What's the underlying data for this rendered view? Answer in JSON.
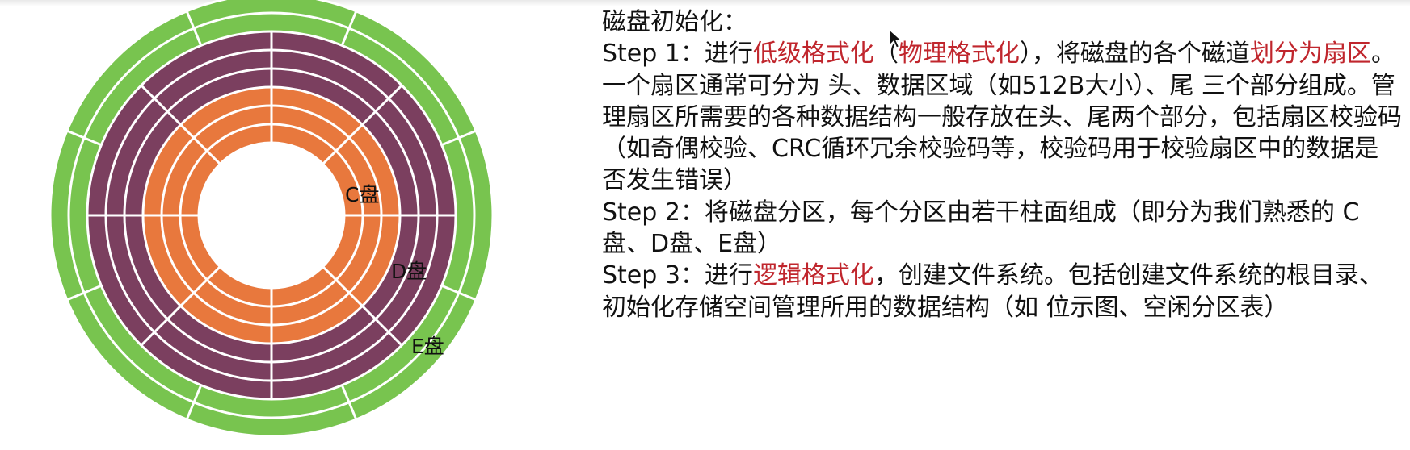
{
  "disk": {
    "labels": {
      "c": "C盘",
      "d": "D盘",
      "e": "E盘"
    },
    "colors": {
      "c_partition": "#e8783d",
      "d_partition": "#7b3f5f",
      "e_partition": "#78c44f",
      "separator": "#ffffff"
    },
    "zones": [
      "C盘",
      "D盘",
      "E盘"
    ],
    "tracks_per_zone": [
      3,
      3,
      2
    ]
  },
  "text": {
    "title": "磁盘初始化：",
    "step1": {
      "lead": "Step 1：进行",
      "term1": "低级格式化",
      "paren_open": "（",
      "term2": "物理格式化",
      "mid": "），将磁盘的各个磁道",
      "term3": "划分为扇区",
      "rest": "。一个扇区通常可分为 头、数据区域（如512B大小）、尾 三个部分组成。管理扇区所需要的各种数据结构一般存放在头、尾两个部分，包括扇区校验码（如奇偶校验、CRC循环冗余校验码等，校验码用于校验扇区中的数据是否发生错误）"
    },
    "step2": "Step 2：将磁盘分区，每个分区由若干柱面组成（即分为我们熟悉的 C盘、D盘、E盘）",
    "step3": {
      "lead": "Step 3：进行",
      "term": "逻辑格式化",
      "rest": "，创建文件系统。包括创建文件系统的根目录、初始化存储空间管理所用的数据结构（如 位示图、空闲分区表）"
    }
  }
}
